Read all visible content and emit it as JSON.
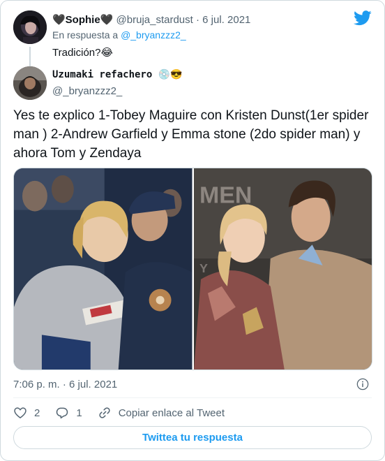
{
  "parent_tweet": {
    "display_name": "🖤Sophie🖤",
    "handle": "@bruja_stardust",
    "separator": "·",
    "date": "6 jul. 2021",
    "reply_prefix": "En respuesta a",
    "reply_to": "@_bryanzzz2_",
    "text": "Tradición?😂"
  },
  "tweet": {
    "display_name": "Uzumaki refachero 💿😎",
    "handle": "@_bryanzzz2_",
    "text": "Yes te explico 1-Tobey Maguire con Kristen Dunst(1er spider man ) 2-Andrew Garfield y Emma stone (2do spider man) y ahora Tom y Zendaya",
    "timestamp": "7:06 p. m. · 6 jul. 2021"
  },
  "actions": {
    "like_count": "2",
    "reply_count": "1",
    "copy_link_label": "Copiar enlace al Tweet"
  },
  "reply_button_label": "Twittea tu respuesta",
  "colors": {
    "accent": "#1d9bf0",
    "text": "#0f1419",
    "secondary": "#536471",
    "border": "#cfd9de"
  },
  "icons": [
    "twitter-bird-icon",
    "info-icon",
    "heart-icon",
    "reply-icon",
    "link-icon"
  ]
}
